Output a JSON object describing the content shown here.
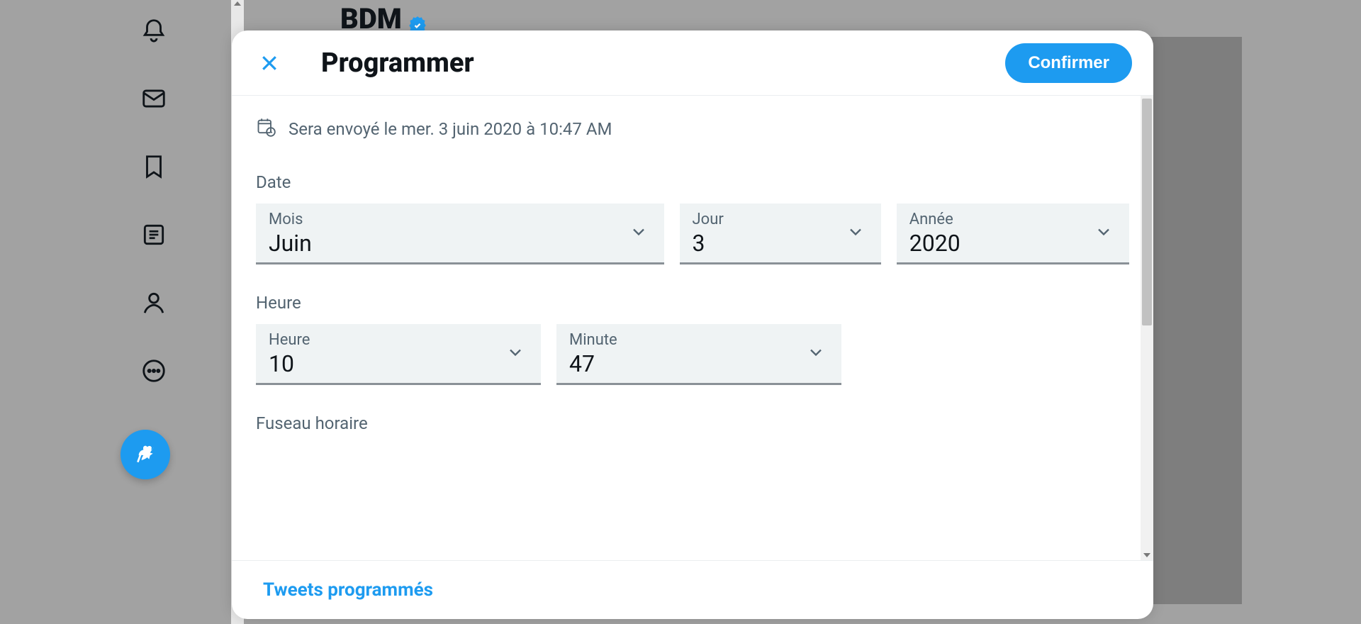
{
  "background": {
    "peek_account": "BDM"
  },
  "modal": {
    "title": "Programmer",
    "confirm_label": "Confirmer",
    "schedule_summary": "Sera envoyé le mer. 3 juin 2020 à 10:47 AM",
    "date_section": "Date",
    "time_section": "Heure",
    "timezone_section": "Fuseau horaire",
    "fields": {
      "month": {
        "label": "Mois",
        "value": "Juin"
      },
      "day": {
        "label": "Jour",
        "value": "3"
      },
      "year": {
        "label": "Année",
        "value": "2020"
      },
      "hour": {
        "label": "Heure",
        "value": "10"
      },
      "minute": {
        "label": "Minute",
        "value": "47"
      }
    },
    "footer_link": "Tweets programmés"
  }
}
